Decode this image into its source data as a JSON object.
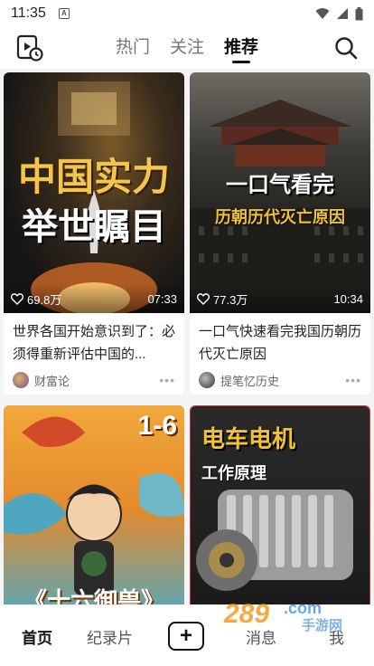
{
  "status_bar": {
    "time": "11:35",
    "notif_badge": "A"
  },
  "top_nav": {
    "tabs": [
      {
        "label": "热门",
        "active": false
      },
      {
        "label": "关注",
        "active": false
      },
      {
        "label": "推荐",
        "active": true
      }
    ]
  },
  "feed": {
    "cards": [
      {
        "cover_text_line1": "中国实力",
        "cover_text_line2": "举世瞩目",
        "likes": "69.8万",
        "duration": "07:33",
        "title": "世界各国开始意识到了：必须得重新评估中国的...",
        "author": "财富论"
      },
      {
        "cover_text_line1": "一口气看完",
        "cover_text_line2": "历朝历代灭亡原因",
        "likes": "77.3万",
        "duration": "10:34",
        "title": "一口气快速看完我国历朝历代灭亡原因",
        "author": "提笔忆历史"
      },
      {
        "cover_text_line1": "1-6",
        "cover_text_line2": "《十六御兽》"
      },
      {
        "cover_text_line1": "电车电机",
        "cover_text_line2": "工作原理"
      }
    ]
  },
  "bottom_nav": {
    "items": [
      {
        "label": "首页",
        "active": true
      },
      {
        "label": "纪录片",
        "active": false
      },
      {
        "label": "消息",
        "active": false
      },
      {
        "label": "我",
        "active": false
      }
    ],
    "plus_label": "+"
  },
  "watermark": {
    "brand_number": "289",
    "brand_suffix": ".com",
    "brand_subtitle": "手游网"
  },
  "colors": {
    "accent": "#111111",
    "background": "#f4f4f4",
    "card": "#ffffff"
  }
}
